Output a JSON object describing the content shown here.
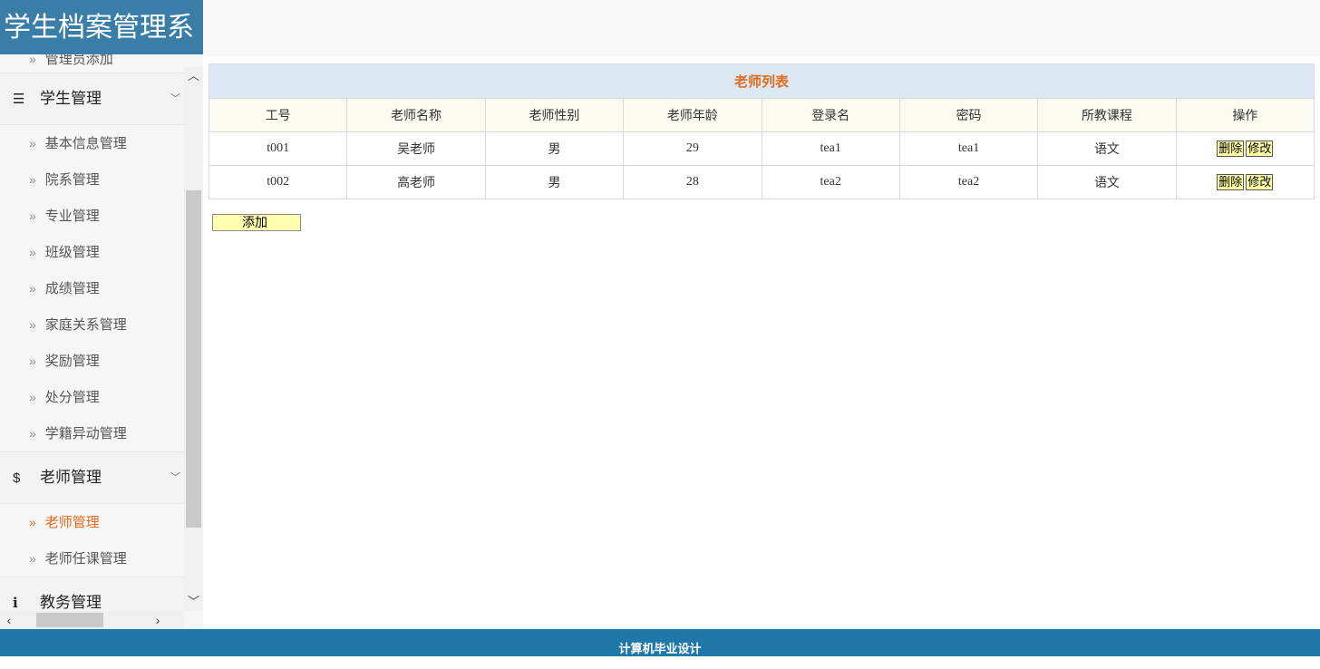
{
  "header": {
    "title": "学生档案管理系"
  },
  "sidebar": {
    "partial_item": "管理员添加",
    "groups": [
      {
        "label": "学生管理",
        "icon": "list-icon",
        "items": [
          "基本信息管理",
          "院系管理",
          "专业管理",
          "班级管理",
          "成绩管理",
          "家庭关系管理",
          "奖励管理",
          "处分管理",
          "学籍异动管理"
        ]
      },
      {
        "label": "老师管理",
        "icon": "dollar-icon",
        "items": [
          "老师管理",
          "老师任课管理"
        ],
        "active_item": "老师管理"
      },
      {
        "label": "教务管理",
        "icon": "info-icon",
        "items": []
      }
    ]
  },
  "table": {
    "caption": "老师列表",
    "columns": [
      "工号",
      "老师名称",
      "老师性别",
      "老师年龄",
      "登录名",
      "密码",
      "所教课程",
      "操作"
    ],
    "rows": [
      [
        "t001",
        "吴老师",
        "男",
        "29",
        "tea1",
        "tea1",
        "语文"
      ],
      [
        "t002",
        "高老师",
        "男",
        "28",
        "tea2",
        "tea2",
        "语文"
      ]
    ],
    "delete_label": "删除",
    "edit_label": "修改"
  },
  "add_button": "添加",
  "footer": {
    "text": "计算机毕业设计"
  },
  "colors": {
    "brand": "#3a7ea7",
    "footer": "#1f78a8",
    "active": "#e06a1e",
    "caption_bg": "#dce8f4",
    "button_bg": "#ffffa8"
  }
}
